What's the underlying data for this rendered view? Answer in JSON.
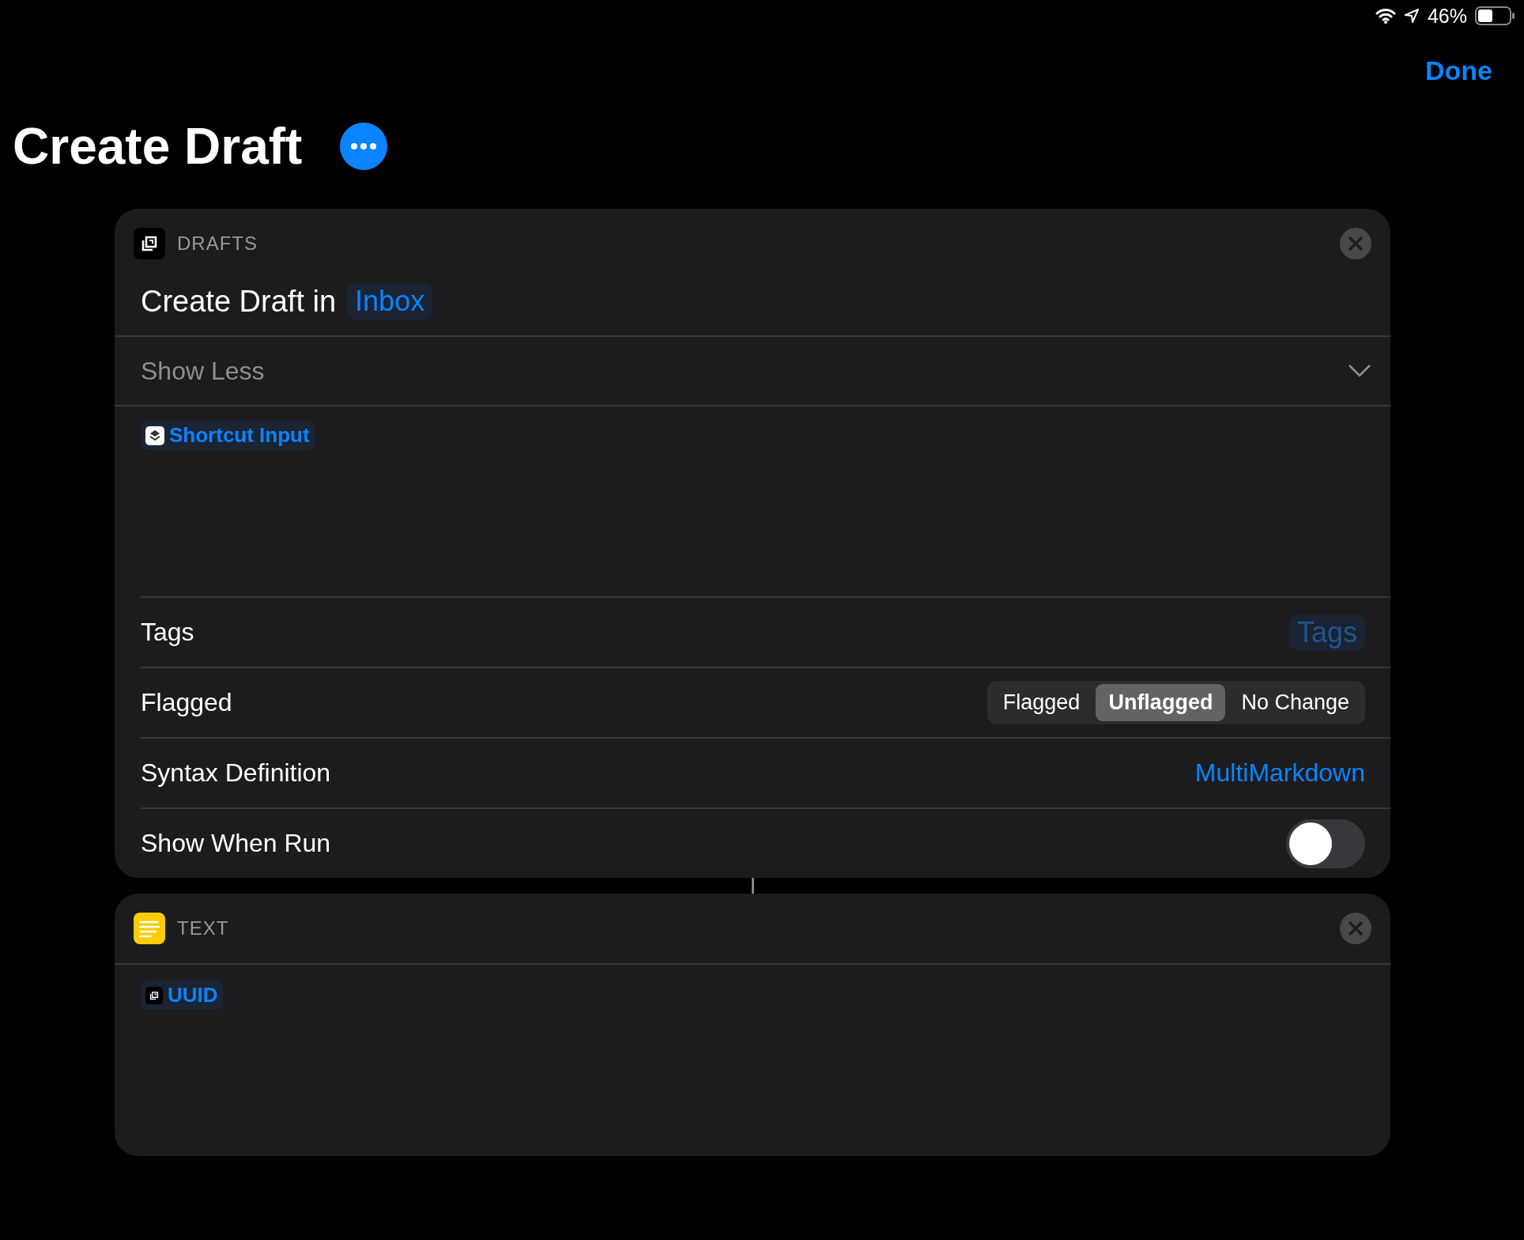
{
  "status_bar": {
    "battery_text": "46%"
  },
  "nav": {
    "done": "Done",
    "title": "Create Draft"
  },
  "actions": [
    {
      "kind": "drafts",
      "app": "DRAFTS",
      "summary_text": "Create Draft in",
      "summary_param": "Inbox",
      "expander": {
        "label": "Show Less",
        "expanded": true
      },
      "token": {
        "kind": "shortcut",
        "label": "Shortcut Input"
      },
      "params": [
        {
          "kind": "token",
          "label": "Tags",
          "placeholder": "Tags"
        },
        {
          "kind": "segmented",
          "label": "Flagged",
          "options": [
            {
              "label": "Flagged",
              "selected": false
            },
            {
              "label": "Unflagged",
              "selected": true
            },
            {
              "label": "No Change",
              "selected": false
            }
          ]
        },
        {
          "kind": "value",
          "label": "Syntax Definition",
          "value": "MultiMarkdown"
        },
        {
          "kind": "toggle",
          "label": "Show When Run",
          "on": false
        }
      ]
    },
    {
      "kind": "text",
      "app": "TEXT",
      "token": {
        "kind": "drafts",
        "label": "UUID"
      }
    }
  ]
}
